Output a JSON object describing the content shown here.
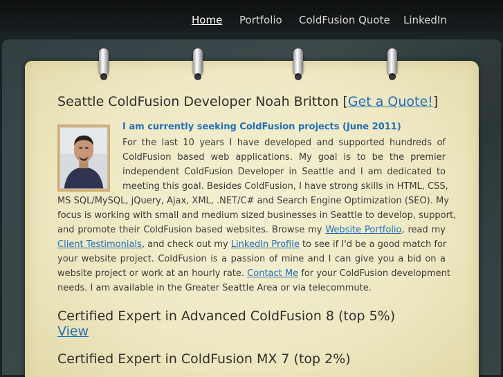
{
  "nav": {
    "items": [
      {
        "label": "Home",
        "active": true
      },
      {
        "label": "Portfolio",
        "active": false
      },
      {
        "label": "ColdFusion Quote",
        "active": false
      },
      {
        "label": "LinkedIn",
        "active": false
      }
    ]
  },
  "main": {
    "title_text": "Seattle ColdFusion Developer Noah Britton [",
    "title_link": "Get a Quote!",
    "title_end": "]",
    "lead": "I am currently seeking ColdFusion projects (June 2011)",
    "lines_narrow": [
      "For the last 10 years I have developed and supported hundreds of",
      "ColdFusion based web applications. My goal is to be the premier",
      "independent ColdFusion Developer in Seattle and I am dedicated to",
      "meeting this goal. Besides ColdFusion, I have strong skills in HTML, CSS,"
    ],
    "line_wide_1": "MS SQL/MySQL, jQuery, Ajax, XML, .NET/C# and Search Engine Optimization (SEO). My",
    "line_wide_2": "focus is working with small and medium sized businesses in Seattle to develop, support,",
    "line_wide_3_pre": "and promote their ColdFusion based websites. Browse my ",
    "link_portfolio": "Website Portfolio",
    "line_wide_3_post": ", read my",
    "link_testimonials": "Client Testimonials",
    "line_wide_4_mid": ", and check out my ",
    "link_linkedin": "LinkedIn Profile",
    "line_wide_4_post": " to see if I'd be a good match for",
    "line_wide_5": "your website project. ColdFusion is a passion of mine and I can give you a bid on a",
    "line_wide_6_pre": "website project or work at an hourly rate. ",
    "link_contact": "Contact Me",
    "line_wide_6_post": " for your ColdFusion development",
    "line_wide_7": "needs. I am available in the Greater Seattle Area or via telecommute.",
    "cert1": "Certified Expert in Advanced ColdFusion 8 (top 5%)",
    "cert1_link": "View",
    "cert2": "Certified Expert in ColdFusion MX 7 (top 2%)"
  }
}
